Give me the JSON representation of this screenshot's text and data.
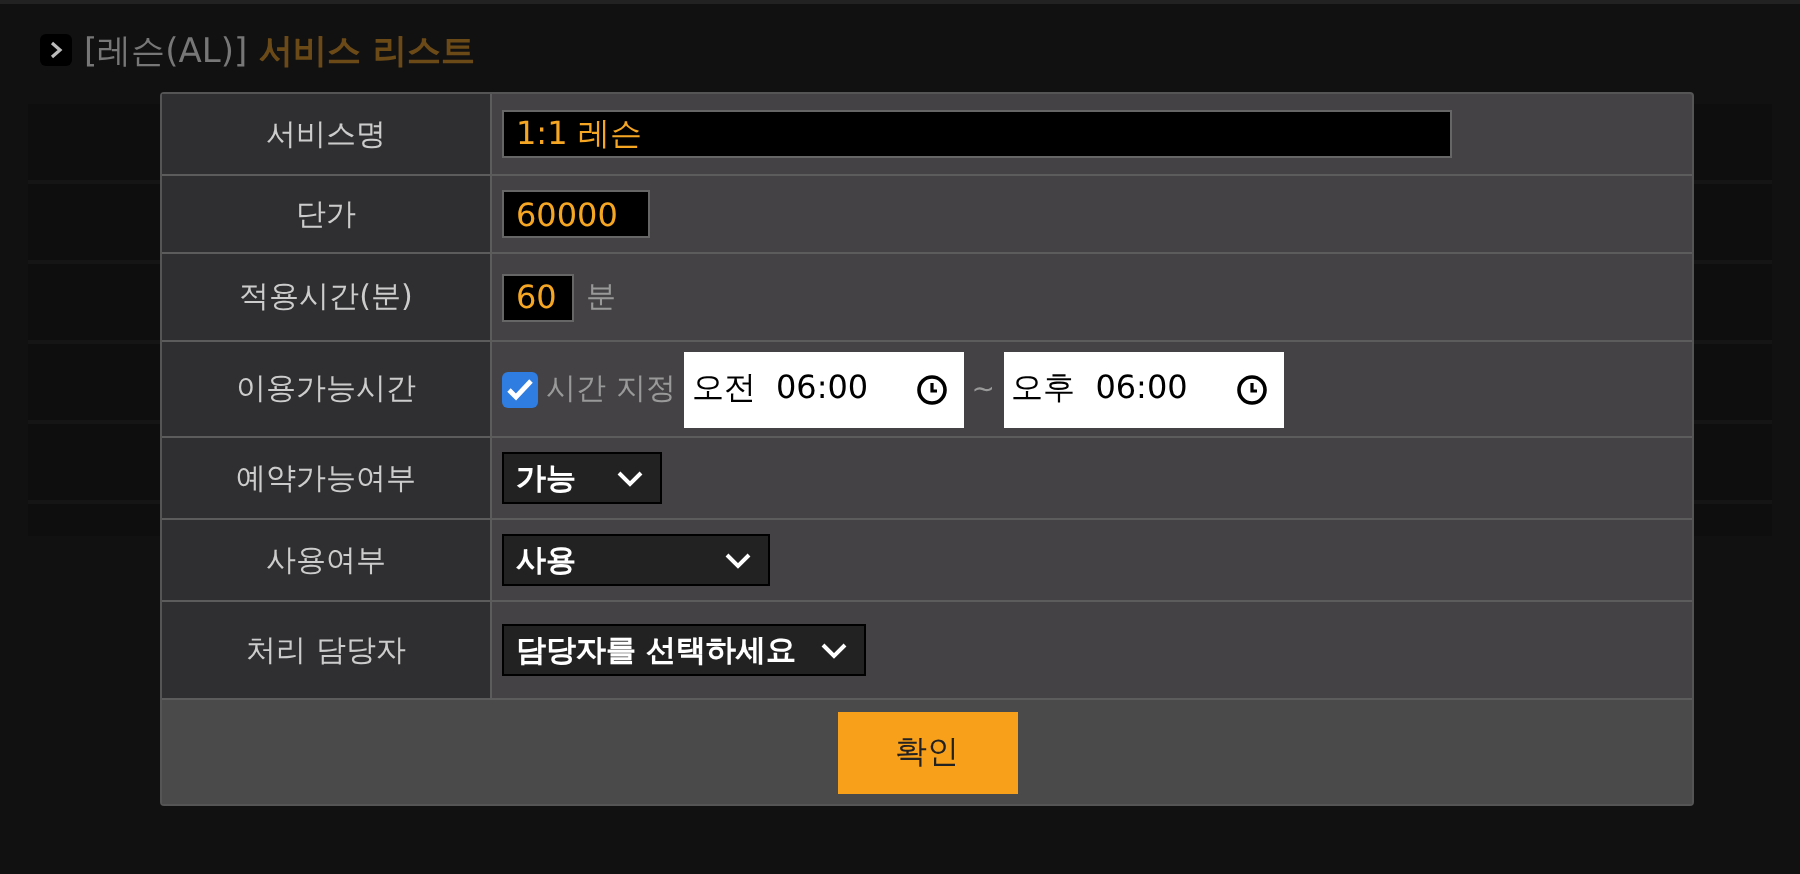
{
  "header": {
    "prefix": "[레슨(AL)]",
    "title": "서비스 리스트"
  },
  "form": {
    "rows": [
      {
        "kind": "text",
        "label": "서비스명",
        "value": "1:1 레슨"
      },
      {
        "kind": "text",
        "label": "단가",
        "value": "60000"
      },
      {
        "kind": "number_unit",
        "label": "적용시간(분)",
        "value": "60",
        "unit": "분"
      },
      {
        "kind": "time_range",
        "label": "이용가능시간",
        "checkbox_label": "시간 지정",
        "checked": true,
        "start": {
          "period": "오전",
          "time": "06:00"
        },
        "separator": "~",
        "end": {
          "period": "오후",
          "time": "06:00"
        }
      },
      {
        "kind": "select",
        "label": "예약가능여부",
        "value": "가능"
      },
      {
        "kind": "select",
        "label": "사용여부",
        "value": "사용"
      },
      {
        "kind": "select",
        "label": "처리 담당자",
        "value": "담당자를 선택하세요"
      }
    ]
  },
  "buttons": [
    {
      "label": "확인"
    }
  ]
}
